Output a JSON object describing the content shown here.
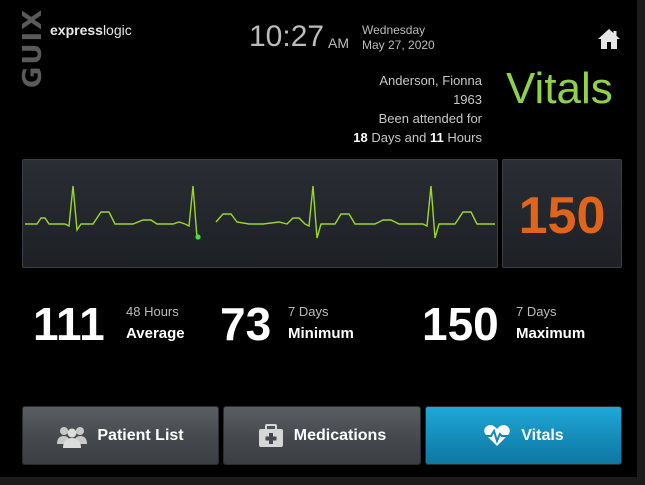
{
  "brand": {
    "logo_text": "GUIX",
    "name_bold": "express",
    "name_light": "logic"
  },
  "clock": {
    "time": "10:27",
    "ampm": "AM",
    "weekday": "Wednesday",
    "date": "May 27, 2020"
  },
  "patient": {
    "name": "Anderson, Fionna",
    "year": "1963",
    "attended_label": "Been attended for",
    "days": "18",
    "days_label": "Days and",
    "hours": "11",
    "hours_label": "Hours"
  },
  "screen_title": "Vitals",
  "heart_rate": {
    "current": "150"
  },
  "stats": [
    {
      "value": "111",
      "period": "48 Hours",
      "label": "Average"
    },
    {
      "value": "73",
      "period": "7 Days",
      "label": "Minimum"
    },
    {
      "value": "150",
      "period": "7 Days",
      "label": "Maximum"
    }
  ],
  "nav": [
    {
      "label": "Patient List",
      "icon": "users-icon"
    },
    {
      "label": "Medications",
      "icon": "medical-kit-icon"
    },
    {
      "label": "Vitals",
      "icon": "heart-pulse-icon",
      "active": true
    }
  ],
  "colors": {
    "accent_green": "#8fd24a",
    "heart_rate": "#e0641a",
    "active_tab": "#1a96c6",
    "ecg_line": "#9bd62a"
  },
  "ecg_trace_icon": "ecg-waveform"
}
